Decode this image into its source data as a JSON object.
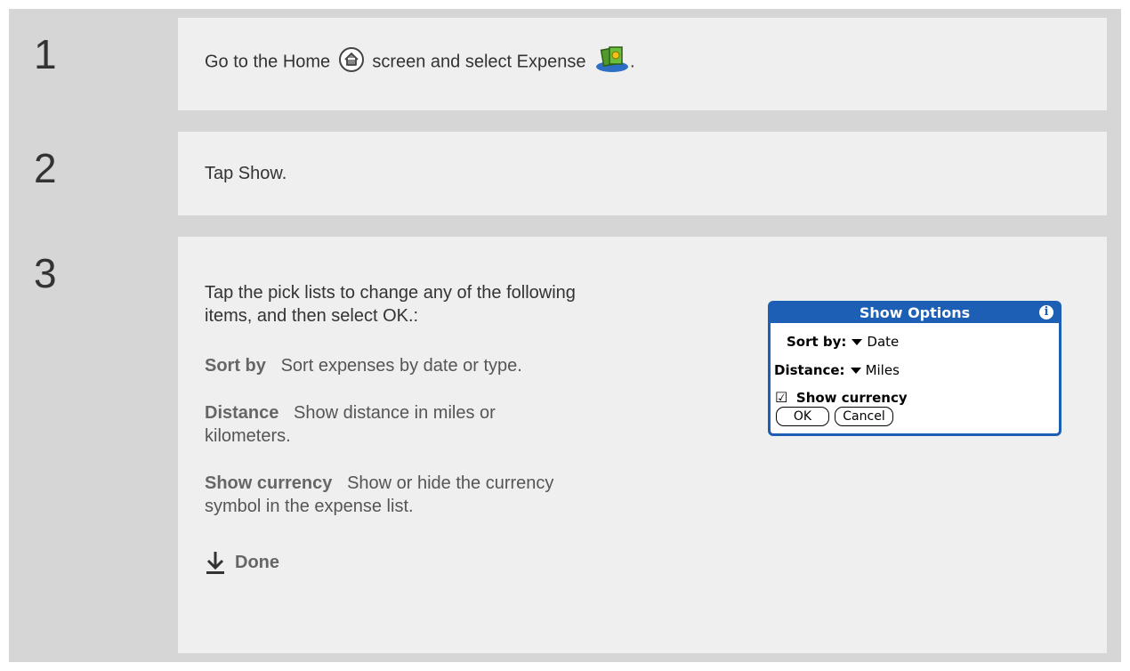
{
  "steps": [
    {
      "number": "1",
      "text_before_home": "Go to the Home",
      "text_before_expense": "screen and select Expense",
      "text_end": "."
    },
    {
      "number": "2",
      "text": "Tap Show."
    },
    {
      "number": "3",
      "intro_line1": "Tap the pick lists to change any of the following",
      "intro_line2": "items, and then select OK.:",
      "options": [
        {
          "term": "Sort by",
          "desc_line1": "Sort expenses by date or type.",
          "desc_line2": ""
        },
        {
          "term": "Distance",
          "desc_line1": "Show distance in miles or",
          "desc_line2": "kilometers."
        },
        {
          "term": "Show currency",
          "desc_line1": "Show or hide the currency",
          "desc_line2": "symbol in the expense list."
        }
      ],
      "done_label": "Done"
    }
  ],
  "dialog": {
    "title": "Show Options",
    "info_glyph": "i",
    "sort_label": "Sort by:",
    "sort_value": "Date",
    "distance_label": "Distance:",
    "distance_value": "Miles",
    "checkbox_glyph": "☑",
    "currency_label": "Show currency",
    "ok_label": "OK",
    "cancel_label": "Cancel"
  },
  "icons": {
    "home": "home-icon",
    "expense": "expense-icon",
    "done": "done-arrow-icon"
  },
  "colors": {
    "background": "#d6d6d6",
    "panel": "#efefef",
    "dialog_accent": "#1d5fb4"
  }
}
